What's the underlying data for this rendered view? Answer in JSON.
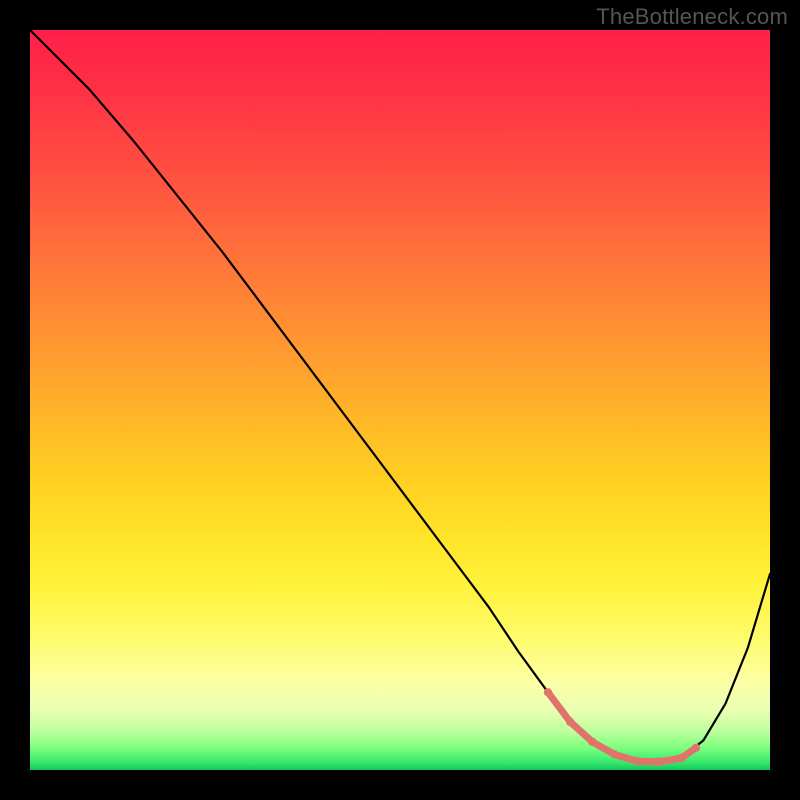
{
  "watermark": "TheBottleneck.com",
  "colors": {
    "background": "#000000",
    "curve": "#000000",
    "marker": "#e2736b",
    "gradient_top": "#ff1f4a",
    "gradient_bottom": "#15c85c"
  },
  "chart_data": {
    "type": "line",
    "title": "",
    "xlabel": "",
    "ylabel": "",
    "xlim": [
      0,
      100
    ],
    "ylim": [
      0,
      100
    ],
    "x": [
      0,
      3,
      8,
      14,
      20,
      26,
      32,
      38,
      44,
      50,
      56,
      62,
      66,
      70,
      73,
      76,
      79,
      82,
      85,
      88,
      91,
      94,
      97,
      100
    ],
    "values": [
      100,
      97,
      92,
      85,
      77.5,
      70,
      62,
      54,
      46,
      38,
      30,
      22,
      16,
      10.5,
      6.5,
      3.8,
      2.1,
      1.2,
      1.1,
      1.6,
      4.0,
      9.0,
      16.5,
      26.5
    ],
    "marker_region": {
      "x": [
        70,
        73,
        76,
        79,
        82,
        85,
        88,
        90
      ],
      "values": [
        10.5,
        6.5,
        3.8,
        2.1,
        1.2,
        1.1,
        1.6,
        3.0
      ]
    },
    "annotations": []
  }
}
